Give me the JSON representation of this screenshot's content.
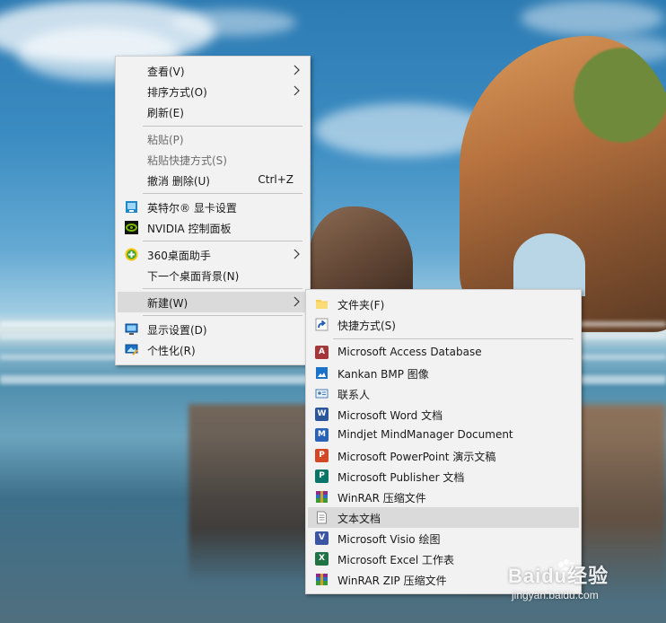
{
  "main_menu": {
    "items": [
      {
        "label": "查看(V)",
        "submenu": true
      },
      {
        "label": "排序方式(O)",
        "submenu": true
      },
      {
        "label": "刷新(E)"
      },
      {
        "label": "粘贴(P)",
        "disabled": true
      },
      {
        "label": "粘贴快捷方式(S)",
        "disabled": true
      },
      {
        "label": "撤消 删除(U)",
        "shortcut": "Ctrl+Z"
      },
      {
        "label": "英特尔® 显卡设置",
        "icon": "intel-graphics-icon"
      },
      {
        "label": "NVIDIA 控制面板",
        "icon": "nvidia-icon"
      },
      {
        "label": "360桌面助手",
        "icon": "360-assistant-icon",
        "submenu": true
      },
      {
        "label": "下一个桌面背景(N)"
      },
      {
        "label": "新建(W)",
        "submenu": true,
        "highlighted": true
      },
      {
        "label": "显示设置(D)",
        "icon": "display-settings-icon"
      },
      {
        "label": "个性化(R)",
        "icon": "personalize-icon"
      }
    ]
  },
  "new_submenu": {
    "items": [
      {
        "label": "文件夹(F)",
        "icon": "folder-icon"
      },
      {
        "label": "快捷方式(S)",
        "icon": "shortcut-icon"
      },
      {
        "label": "Microsoft Access Database",
        "icon": "access-icon"
      },
      {
        "label": "Kankan BMP 图像",
        "icon": "bmp-image-icon"
      },
      {
        "label": "联系人",
        "icon": "contact-icon"
      },
      {
        "label": "Microsoft Word 文档",
        "icon": "word-icon"
      },
      {
        "label": "Mindjet MindManager Document",
        "icon": "mindmanager-icon"
      },
      {
        "label": "Microsoft PowerPoint 演示文稿",
        "icon": "powerpoint-icon"
      },
      {
        "label": "Microsoft Publisher 文档",
        "icon": "publisher-icon"
      },
      {
        "label": "WinRAR 压缩文件",
        "icon": "winrar-icon"
      },
      {
        "label": "文本文档",
        "icon": "text-document-icon",
        "highlighted": true
      },
      {
        "label": "Microsoft Visio 绘图",
        "icon": "visio-icon"
      },
      {
        "label": "Microsoft Excel 工作表",
        "icon": "excel-icon"
      },
      {
        "label": "WinRAR ZIP 压缩文件",
        "icon": "winrar-zip-icon"
      }
    ]
  },
  "watermark": {
    "brand": "Baidu经验",
    "url": "jingyan.baidu.com"
  },
  "colors": {
    "menu_bg": "#f2f2f2",
    "highlight": "#dadada",
    "disabled_text": "#6d6d6d"
  }
}
